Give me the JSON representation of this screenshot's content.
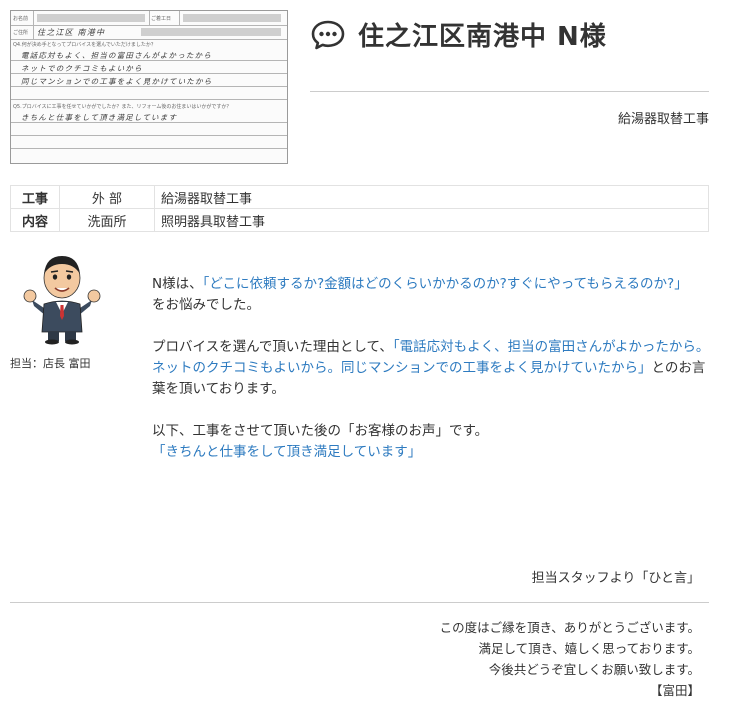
{
  "form": {
    "name_label": "お名前",
    "date_label": "ご着工日",
    "address_label": "ご住所",
    "address_value": "住之江区 南港中",
    "q4_label": "Q4.何が決め手となってプロバイスを選んでいただけましたか？",
    "q4_lines": [
      "電話応対もよく、担当の富田さんがよかったから",
      "ネットでのクチコミもよいから",
      "同じマンションでの工事をよく見かけていたから"
    ],
    "q5_label": "Q5.プロバイスに工事を任せていかがでしたか？また、リフォーム後のお住まいはいかがですか？",
    "q5_lines": [
      "きちんと仕事をして頂き満足しています"
    ]
  },
  "header": {
    "title": "住之江区南港中 N様",
    "subtitle": "給湯器取替工事"
  },
  "work_table": {
    "label_top": "工事",
    "label_bottom": "内容",
    "rows": [
      {
        "location": "外 部",
        "work": "給湯器取替工事"
      },
      {
        "location": "洗面所",
        "work": "照明器具取替工事"
      }
    ]
  },
  "staff": {
    "caption": "担当：店長 富田"
  },
  "body": {
    "p1_pre": "N様は、",
    "p1_quote": "「どこに依頼するか?金額はどのくらいかかるのか?すぐにやってもらえるのか?」",
    "p1_post": "をお悩みでした。",
    "p2_pre": "プロバイスを選んで頂いた理由として、",
    "p2_quote": "「電話応対もよく、担当の富田さんがよかったから。ネットのクチコミもよいから。同じマンションでの工事をよく見かけていたから」",
    "p2_post": "とのお言葉を頂いております。",
    "p3_line": "以下、工事をさせて頂いた後の「お客様のお声」です。",
    "p3_quote": "「きちんと仕事をして頂き満足しています」"
  },
  "footer": {
    "hito": "担当スタッフより「ひと言」",
    "lines": [
      "この度はご縁を頂き、ありがとうございます。",
      "満足して頂き、嬉しく思っております。",
      "今後共どうぞ宜しくお願い致します。",
      "【富田】"
    ]
  },
  "colors": {
    "accent_blue": "#2e7bc0",
    "text": "#333333",
    "divider": "#cccccc"
  },
  "icons": {
    "title_icon": "speech-bubble-icon"
  }
}
